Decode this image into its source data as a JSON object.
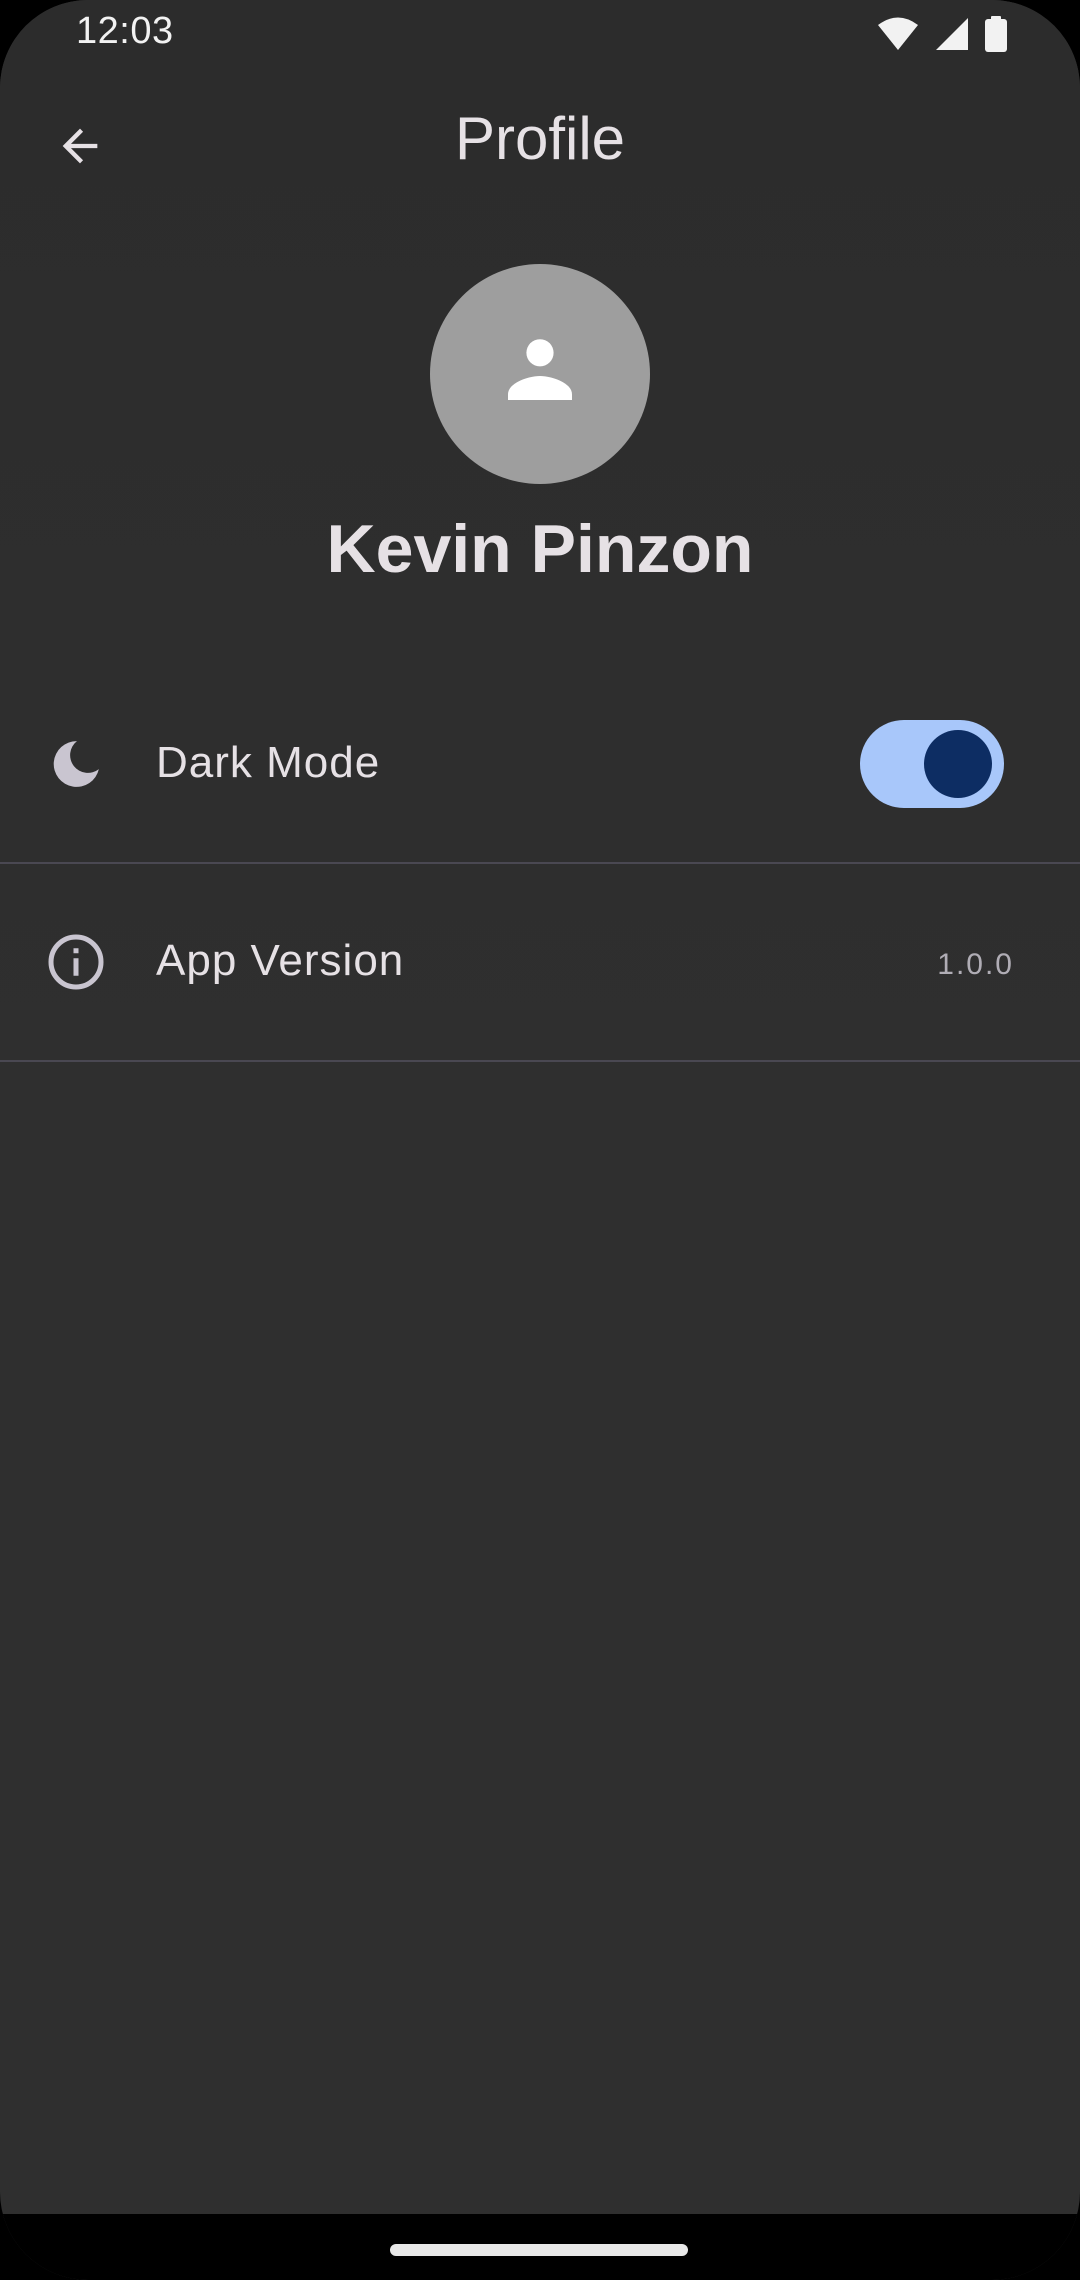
{
  "status_bar": {
    "time": "12:03",
    "icons": [
      "wifi-icon",
      "signal-icon",
      "battery-icon"
    ]
  },
  "app_bar": {
    "title": "Profile",
    "back_icon": "arrow-back-icon"
  },
  "profile": {
    "avatar_icon": "person-icon",
    "name": "Kevin Pinzon"
  },
  "settings": [
    {
      "icon": "moon-icon",
      "label": "Dark Mode",
      "control": "switch",
      "checked": true
    },
    {
      "icon": "info-icon",
      "label": "App Version",
      "value": "1.0.0"
    }
  ],
  "colors": {
    "background": "#2f2f2f",
    "text": "#e6e1e5",
    "switch_track": "#a8c7fa",
    "switch_thumb": "#0d2d63",
    "avatar": "#9e9e9e"
  }
}
